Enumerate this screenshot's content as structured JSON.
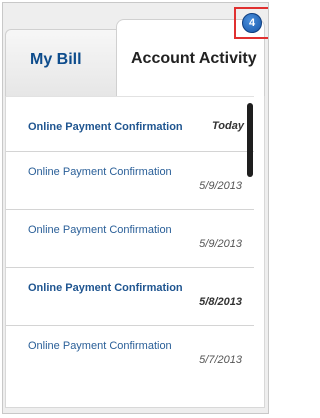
{
  "tabs": {
    "my_bill": "My Bill",
    "account_activity": "Account Activity"
  },
  "badge": {
    "count": "4"
  },
  "activity": [
    {
      "title": "Online Payment Confirmation",
      "date": "Today",
      "unread": true
    },
    {
      "title": "Online Payment Confirmation",
      "date": "5/9/2013",
      "unread": false
    },
    {
      "title": "Online Payment Confirmation",
      "date": "5/9/2013",
      "unread": false
    },
    {
      "title": "Online Payment Confirmation",
      "date": "5/8/2013",
      "unread": true
    },
    {
      "title": "Online Payment Confirmation",
      "date": "5/7/2013",
      "unread": false
    }
  ],
  "colors": {
    "link_blue": "#2a5f98",
    "badge_blue": "#1656a8",
    "highlight_red": "#e03030"
  }
}
